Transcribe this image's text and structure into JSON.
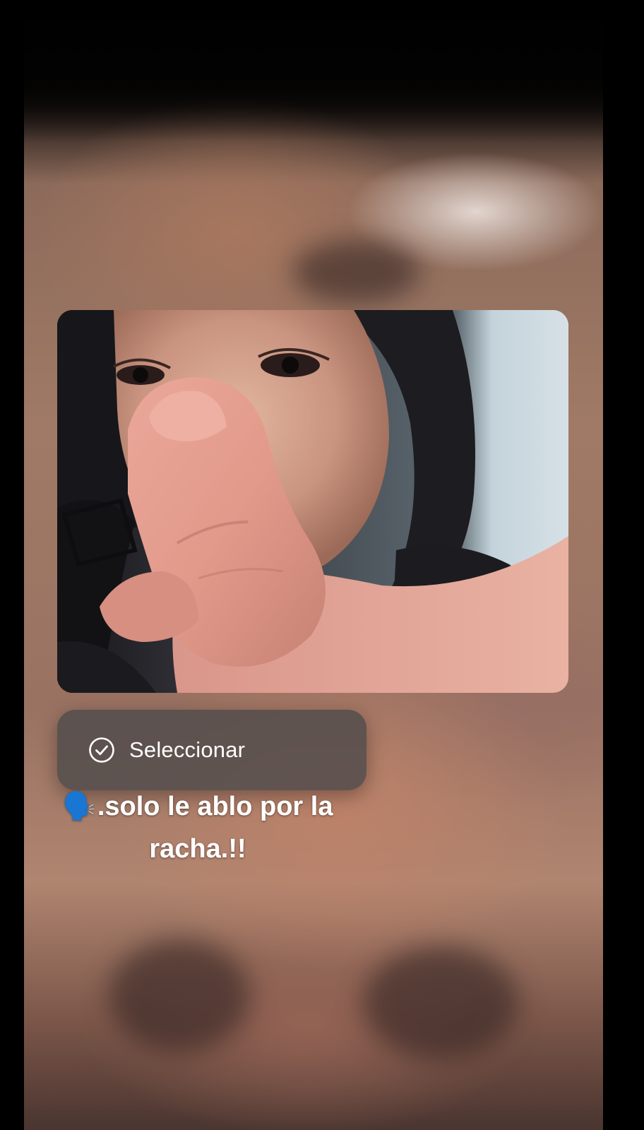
{
  "context_menu": {
    "select_label": "Seleccionar",
    "select_icon": "checkmark-circle-icon"
  },
  "caption": {
    "emoji": "🗣️",
    "text": ".solo le ablo por la racha.!!"
  },
  "photo": {
    "icon": "selfie-photo"
  },
  "colors": {
    "menu_background": "#4e4a4a",
    "menu_text": "#ffffff",
    "caption_text": "#ffffff",
    "screen_background": "#000000"
  }
}
